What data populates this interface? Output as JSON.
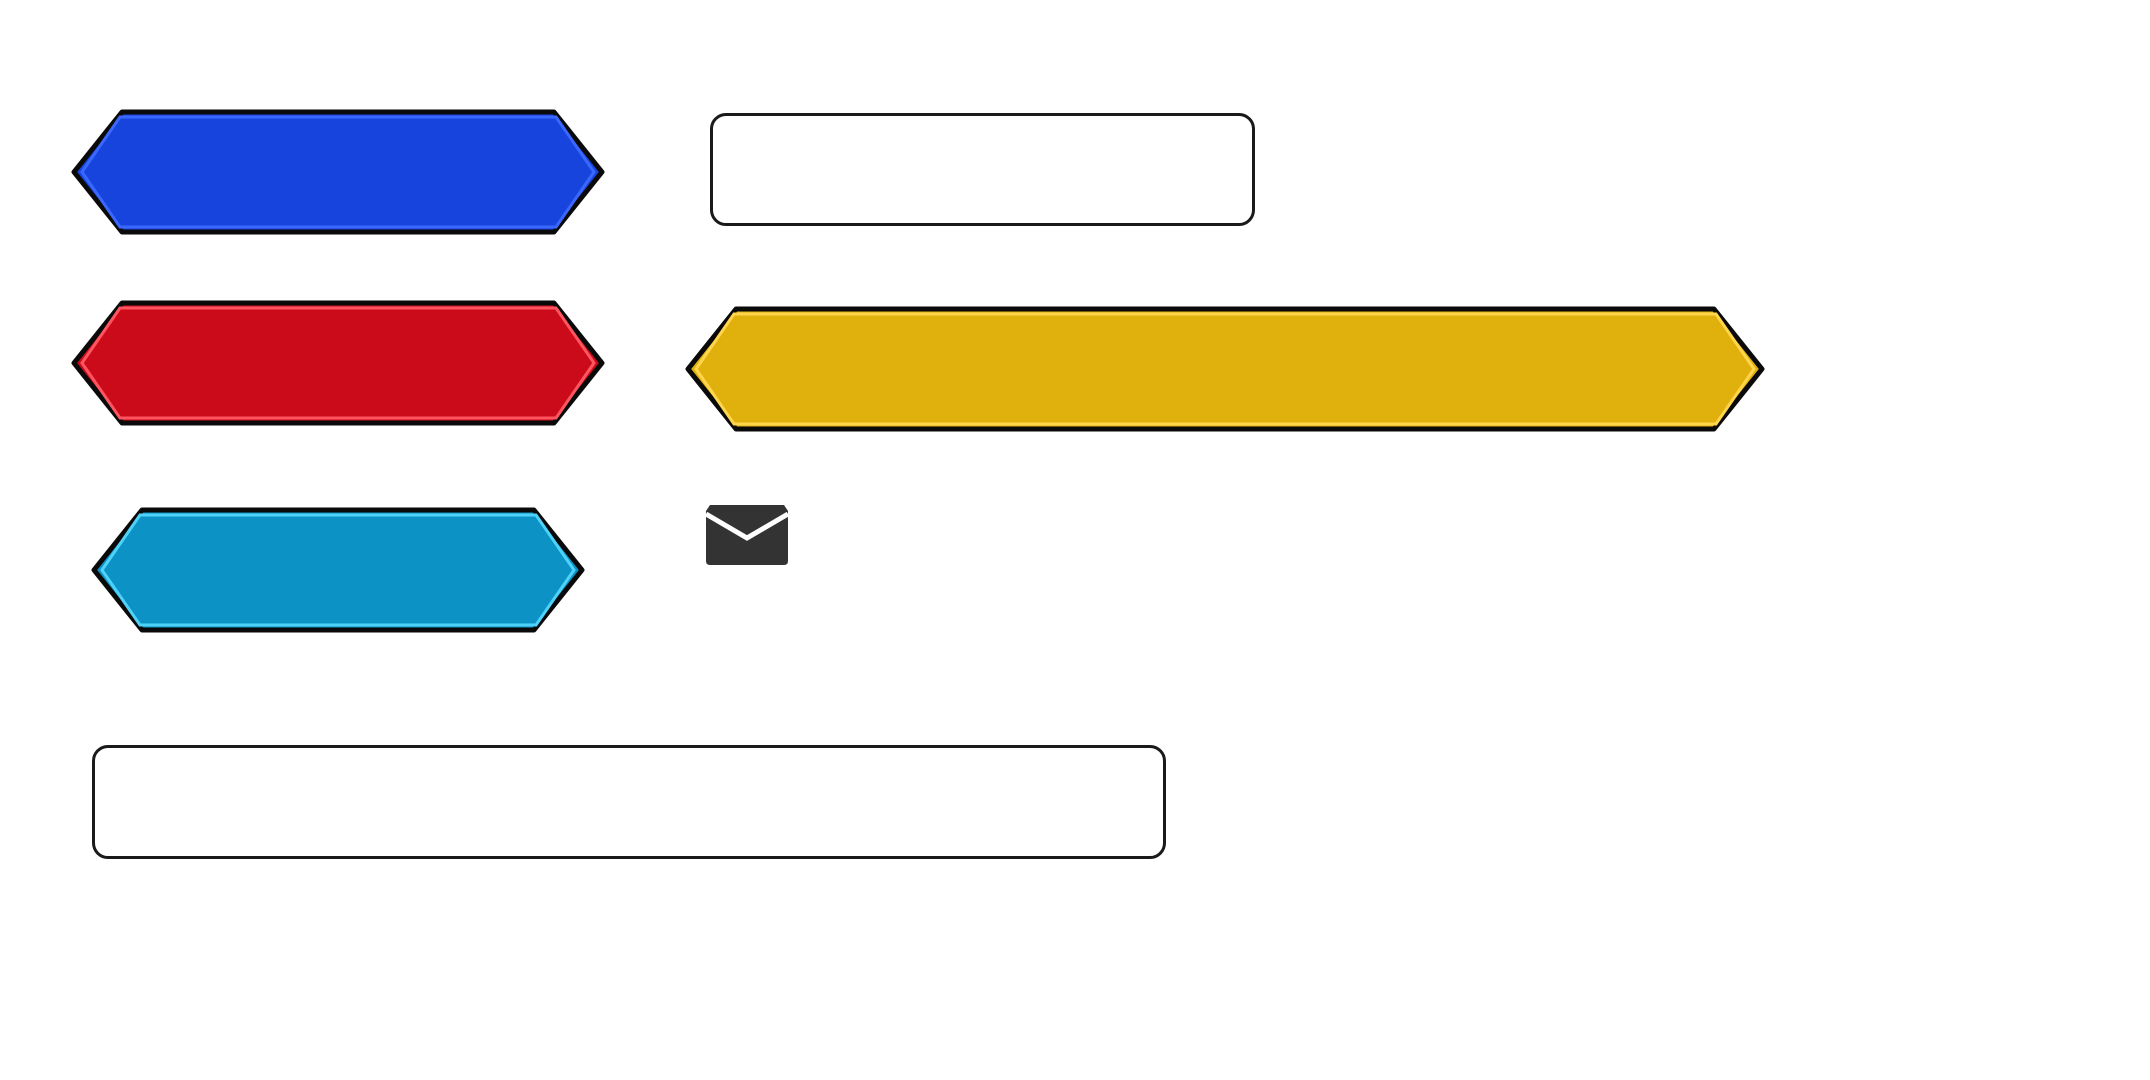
{
  "buttons": {
    "blue": {
      "label": "",
      "fill": "#1844de",
      "inner": "#3a68ff",
      "border": "#0a0a0a"
    },
    "red": {
      "label": "",
      "fill": "#cc0b1a",
      "inner": "#ff5560",
      "border": "#0a0a0a"
    },
    "cyan": {
      "label": "",
      "fill": "#0c92c4",
      "inner": "#4fd2fa",
      "border": "#0a0a0a"
    },
    "yellow": {
      "label": "",
      "fill": "#e0b10c",
      "inner": "#ffd54d",
      "border": "#0a0a0a"
    }
  },
  "fields": {
    "top": {
      "value": "",
      "placeholder": ""
    },
    "bottom": {
      "value": "",
      "placeholder": ""
    }
  },
  "icons": {
    "mail": {
      "name": "envelope-icon",
      "color": "#333333"
    }
  }
}
